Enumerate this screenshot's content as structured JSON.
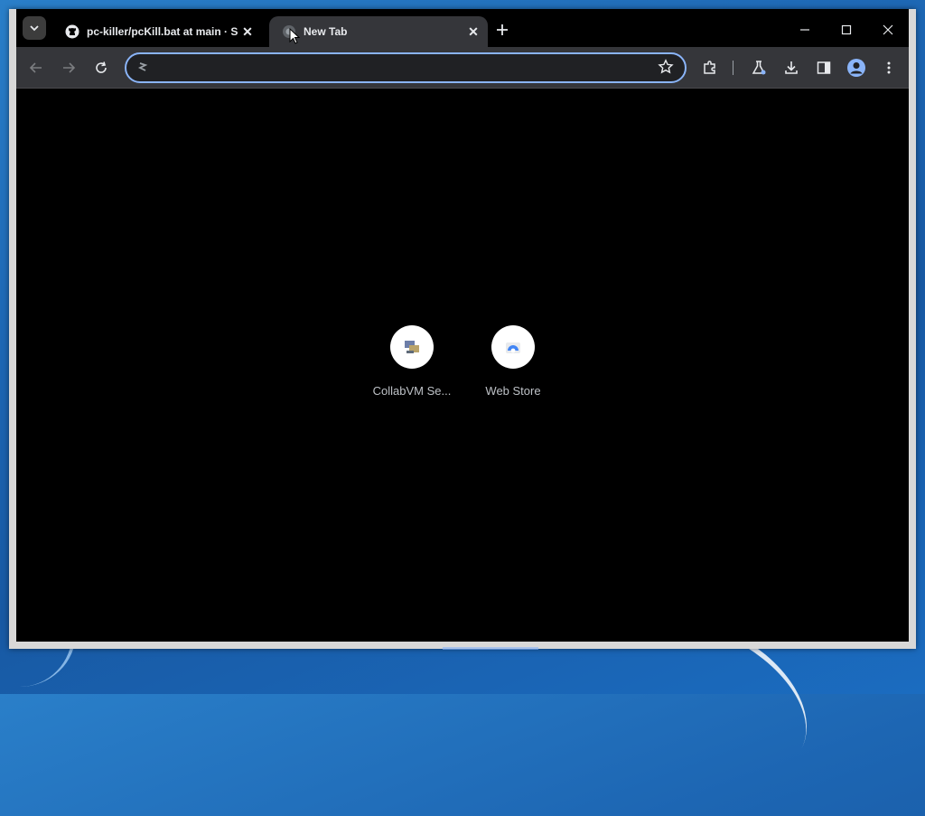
{
  "browser": {
    "tabs": [
      {
        "title": "pc-killer/pcKill.bat at main · So",
        "active": false,
        "favicon": "github-icon"
      },
      {
        "title": "New Tab",
        "active": true,
        "favicon": "globe-icon"
      }
    ],
    "window_controls": [
      "minimize-icon",
      "maximize-icon",
      "close-icon"
    ],
    "toolbar": {
      "omnibox_value": "",
      "omnibox_placeholder": ""
    }
  },
  "new_tab": {
    "shortcuts": [
      {
        "label": "CollabVM Se...",
        "icon": "collabvm-icon"
      },
      {
        "label": "Web Store",
        "icon": "webstore-icon"
      }
    ]
  },
  "colors": {
    "tab_strip": "#000000",
    "toolbar": "#35363a",
    "omnibox_focus": "#8ab4f8",
    "page_background": "#000000"
  }
}
